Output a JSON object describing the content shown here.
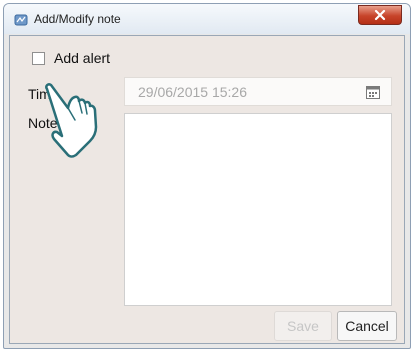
{
  "window": {
    "title": "Add/Modify note"
  },
  "form": {
    "add_alert_label": "Add alert",
    "add_alert_checked": false,
    "time_label": "Tim",
    "time_value": "29/06/2015 15:26",
    "note_label": "Note",
    "note_value": ""
  },
  "buttons": {
    "save": "Save",
    "cancel": "Cancel"
  },
  "icons": {
    "app": "app-icon",
    "close": "close-icon",
    "calendar": "calendar-icon",
    "pointer": "hand-pointer-icon"
  },
  "colors": {
    "close_button": "#c7442a",
    "frame_background": "#ede7e3"
  }
}
